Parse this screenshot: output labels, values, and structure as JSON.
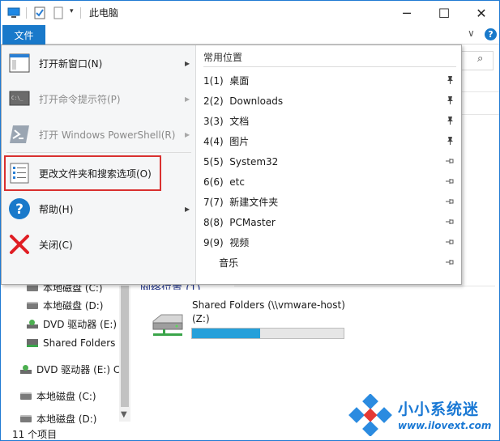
{
  "window": {
    "title": "此电脑"
  },
  "ribbon": {
    "file_tab": "文件",
    "chevron": "∨",
    "help": "?"
  },
  "file_menu": {
    "items": [
      {
        "label": "打开新窗口(N)",
        "enabled": true,
        "icon": "new-window-icon",
        "has_submenu": true
      },
      {
        "label": "打开命令提示符(P)",
        "enabled": false,
        "icon": "cmd-icon",
        "has_submenu": true
      },
      {
        "label": "打开 Windows PowerShell(R)",
        "enabled": false,
        "icon": "powershell-icon",
        "has_submenu": true
      },
      {
        "label": "更改文件夹和搜索选项(O)",
        "enabled": true,
        "icon": "folder-options-icon",
        "has_submenu": false
      },
      {
        "label": "帮助(H)",
        "enabled": true,
        "icon": "help-icon",
        "has_submenu": true
      },
      {
        "label": "关闭(C)",
        "enabled": true,
        "icon": "close-icon",
        "has_submenu": false
      }
    ],
    "places_header": "常用位置",
    "places": [
      {
        "label": "1(1)  桌面",
        "pinned": true
      },
      {
        "label": "2(2)  Downloads",
        "pinned": true
      },
      {
        "label": "3(3)  文档",
        "pinned": true
      },
      {
        "label": "4(4)  图片",
        "pinned": true
      },
      {
        "label": "5(5)  System32",
        "pinned": false
      },
      {
        "label": "6(6)  etc",
        "pinned": false
      },
      {
        "label": "7(7)  新建文件夹",
        "pinned": false
      },
      {
        "label": "8(8)  PCMaster",
        "pinned": false
      },
      {
        "label": "9(9)  视频",
        "pinned": false
      },
      {
        "label": "     音乐",
        "pinned": false
      }
    ]
  },
  "nav": {
    "items": [
      {
        "label": "本地磁盘 (C:)",
        "icon": "drive-icon"
      },
      {
        "label": "本地磁盘 (D:)",
        "icon": "drive-icon"
      },
      {
        "label": "DVD 驱动器 (E:)",
        "icon": "dvd-icon"
      },
      {
        "label": "Shared Folders",
        "icon": "share-icon"
      },
      {
        "label": "DVD 驱动器 (E:) C",
        "icon": "dvd-icon"
      },
      {
        "label": "本地磁盘 (C:)",
        "icon": "drive-icon"
      },
      {
        "label": "本地磁盘 (D:)",
        "icon": "drive-icon"
      }
    ]
  },
  "content": {
    "section_header": "网络位置 (1)",
    "share_name": "Shared Folders (\\\\vmware-host)",
    "share_letter": "(Z:)",
    "capacity_used_fraction": 0.45
  },
  "status": {
    "item_count": "11 个项目"
  },
  "watermark": {
    "title": "小小系统迷",
    "url": "www.ilovext.com"
  },
  "colors": {
    "accent": "#1979ca",
    "highlight_border": "#d9302f",
    "capacity_fill": "#26a0da"
  }
}
